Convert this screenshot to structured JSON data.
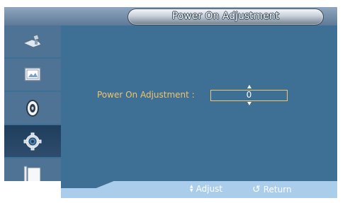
{
  "header": {
    "title": "Power On Adjustment"
  },
  "sidebar": {
    "items": [
      {
        "icon": "input-icon",
        "active": false
      },
      {
        "icon": "picture-icon",
        "active": false
      },
      {
        "icon": "sound-icon",
        "active": false
      },
      {
        "icon": "setup-gear-icon",
        "active": true
      },
      {
        "icon": "multi-control-icon",
        "active": false
      }
    ]
  },
  "main": {
    "field": {
      "label": "Power On Adjustment :",
      "value": "0"
    }
  },
  "footer": {
    "adjust_label": "Adjust",
    "return_label": "Return"
  },
  "colors": {
    "accent": "#f1c46a",
    "background": "#3e6f95",
    "sidebar": "#4e7394",
    "active": "#1f3d5c"
  }
}
